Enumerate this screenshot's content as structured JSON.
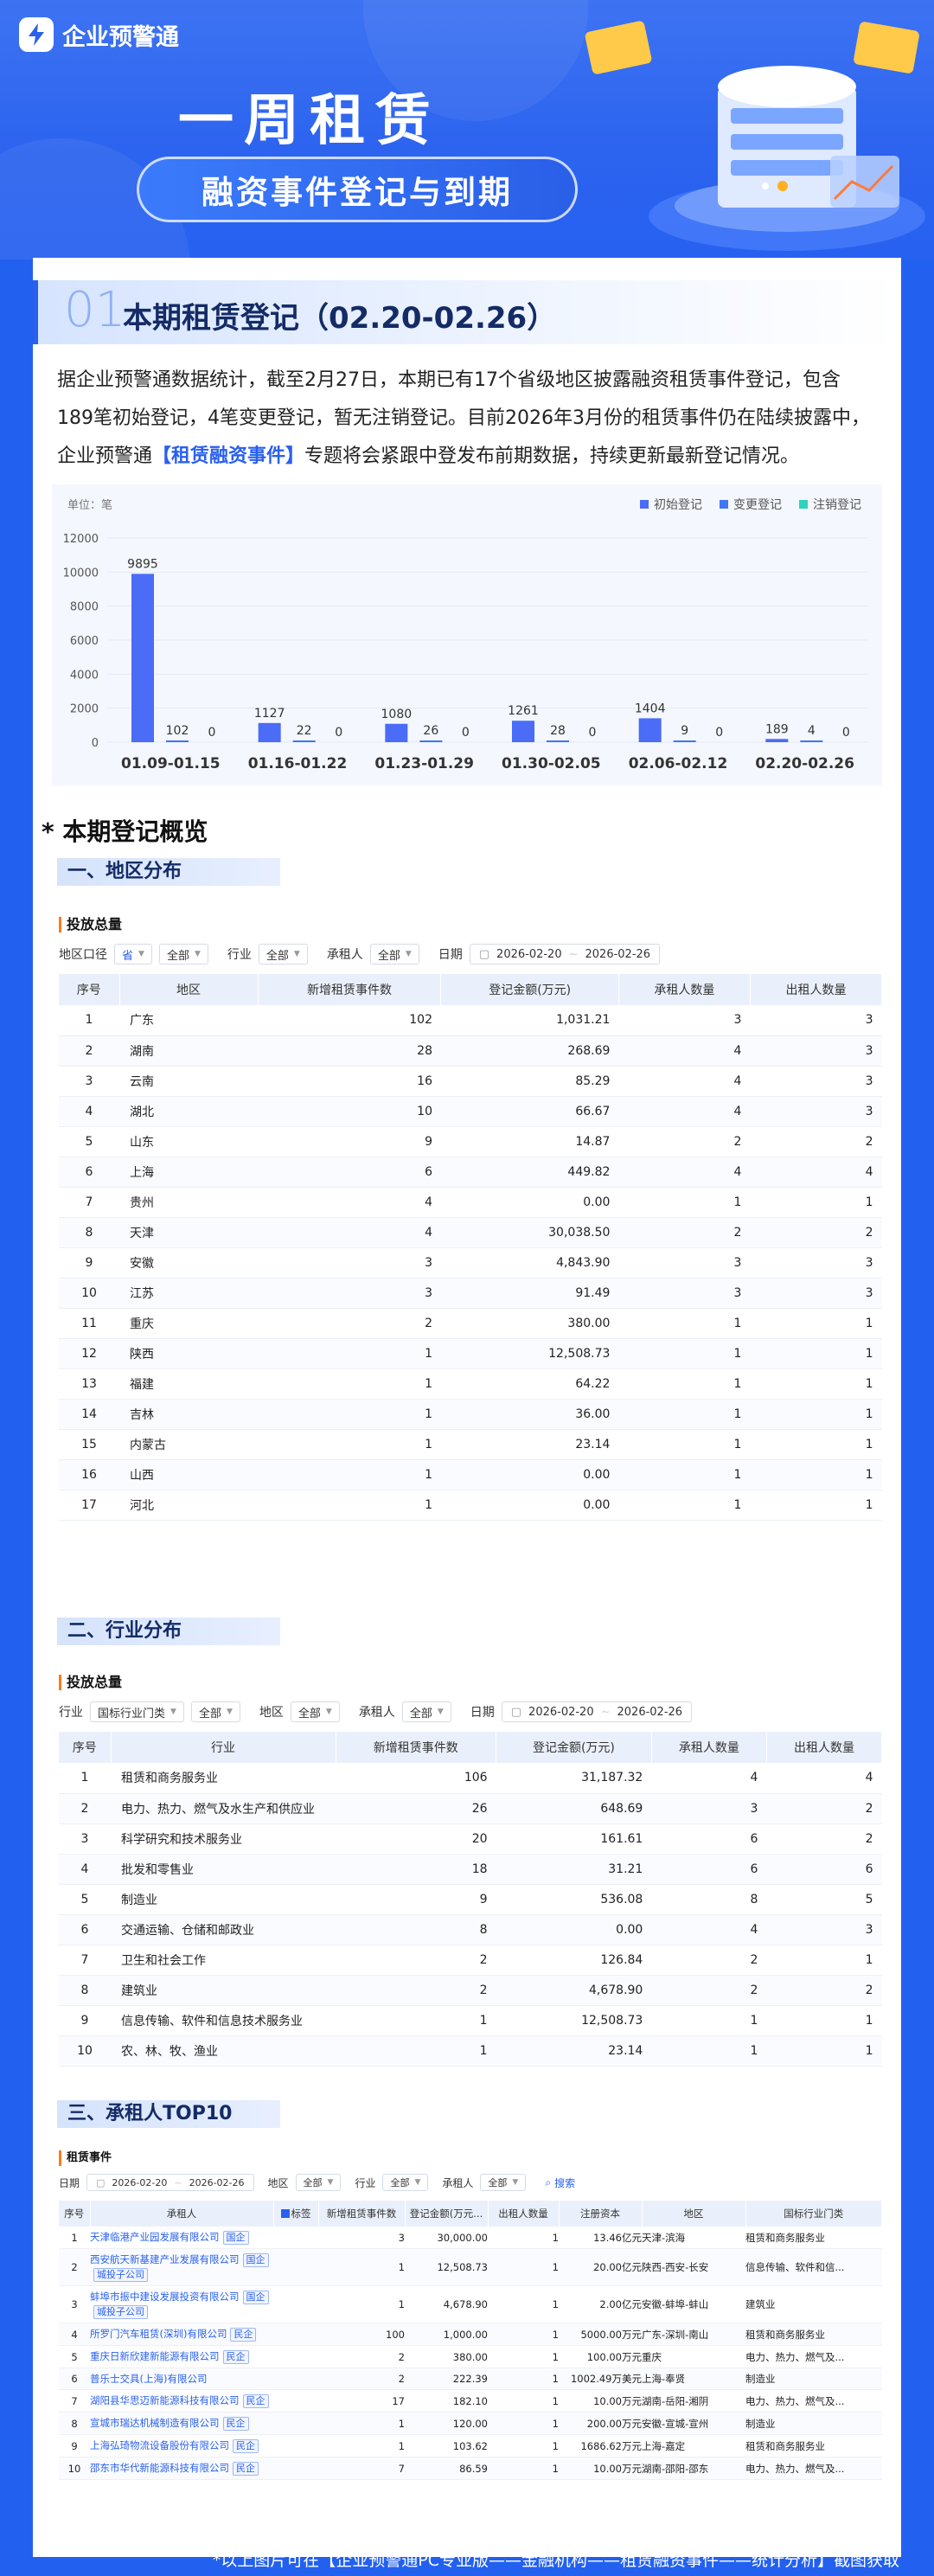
{
  "brand": {
    "name": "企业预警通"
  },
  "hero": {
    "title": "一周租赁",
    "subtitle": "融资事件登记与到期"
  },
  "section1": {
    "number": "01",
    "title": "本期租赁登记（02.20-02.26）"
  },
  "intro": {
    "line1": "据企业预警通数据统计，截至2月27日，本期已有17个省级地区披露融资租赁事件登记，包含",
    "line2": "189笔初始登记，4笔变更登记，暂无注销登记。目前2026年3月份的租赁事件仍在陆续披露中，",
    "line3a": "企业预警通",
    "line3b": "【租赁融资事件】",
    "line3c": "专题将会紧跟中登发布前期数据，持续更新最新登记情况。"
  },
  "chart_data": {
    "type": "bar",
    "unit_label": "单位：笔",
    "categories": [
      "01.09-01.15",
      "01.16-01.22",
      "01.23-01.29",
      "01.30-02.05",
      "02.06-02.12",
      "02.20-02.26"
    ],
    "series": [
      {
        "name": "初始登记",
        "values": [
          9895,
          1127,
          1080,
          1261,
          1404,
          189
        ],
        "color": "#4a6cf7"
      },
      {
        "name": "变更登记",
        "values": [
          102,
          22,
          26,
          28,
          9,
          4
        ],
        "color": "#3f77f4"
      },
      {
        "name": "注销登记",
        "values": [
          0,
          0,
          0,
          0,
          0,
          0
        ],
        "color": "#2ed3c0"
      }
    ],
    "yticks": [
      0,
      2000,
      4000,
      6000,
      8000,
      10000,
      12000
    ],
    "ylim": [
      0,
      12000
    ],
    "legend": "top-right"
  },
  "overview": {
    "title": "*  本期登记概览"
  },
  "region": {
    "subtitle": "一、地区分布",
    "panel_title": "投放总量",
    "filters": {
      "region_label": "地区口径",
      "region_value": "省",
      "all1": "全部",
      "industry_label": "行业",
      "industry_value": "全部",
      "lessee_label": "承租人",
      "lessee_value": "全部",
      "date_label": "日期",
      "date_from": "2026-02-20",
      "date_to": "2026-02-26"
    },
    "headers": [
      "序号",
      "地区",
      "新增租赁事件数",
      "登记金额(万元)",
      "承租人数量",
      "出租人数量"
    ],
    "rows": [
      [
        "1",
        "广东",
        "102",
        "1,031.21",
        "3",
        "3"
      ],
      [
        "2",
        "湖南",
        "28",
        "268.69",
        "4",
        "3"
      ],
      [
        "3",
        "云南",
        "16",
        "85.29",
        "4",
        "3"
      ],
      [
        "4",
        "湖北",
        "10",
        "66.67",
        "4",
        "3"
      ],
      [
        "5",
        "山东",
        "9",
        "14.87",
        "2",
        "2"
      ],
      [
        "6",
        "上海",
        "6",
        "449.82",
        "4",
        "4"
      ],
      [
        "7",
        "贵州",
        "4",
        "0.00",
        "1",
        "1"
      ],
      [
        "8",
        "天津",
        "4",
        "30,038.50",
        "2",
        "2"
      ],
      [
        "9",
        "安徽",
        "3",
        "4,843.90",
        "3",
        "3"
      ],
      [
        "10",
        "江苏",
        "3",
        "91.49",
        "3",
        "3"
      ],
      [
        "11",
        "重庆",
        "2",
        "380.00",
        "1",
        "1"
      ],
      [
        "12",
        "陕西",
        "1",
        "12,508.73",
        "1",
        "1"
      ],
      [
        "13",
        "福建",
        "1",
        "64.22",
        "1",
        "1"
      ],
      [
        "14",
        "吉林",
        "1",
        "36.00",
        "1",
        "1"
      ],
      [
        "15",
        "内蒙古",
        "1",
        "23.14",
        "1",
        "1"
      ],
      [
        "16",
        "山西",
        "1",
        "0.00",
        "1",
        "1"
      ],
      [
        "17",
        "河北",
        "1",
        "0.00",
        "1",
        "1"
      ]
    ]
  },
  "industry": {
    "subtitle": "二、行业分布",
    "panel_title": "投放总量",
    "filters": {
      "industry_label": "行业",
      "industry_value": "国标行业门类",
      "all1": "全部",
      "region_label": "地区",
      "region_value": "全部",
      "lessee_label": "承租人",
      "lessee_value": "全部",
      "date_label": "日期",
      "date_from": "2026-02-20",
      "date_to": "2026-02-26"
    },
    "headers": [
      "序号",
      "行业",
      "新增租赁事件数",
      "登记金额(万元)",
      "承租人数量",
      "出租人数量"
    ],
    "rows": [
      [
        "1",
        "租赁和商务服务业",
        "106",
        "31,187.32",
        "4",
        "4"
      ],
      [
        "2",
        "电力、热力、燃气及水生产和供应业",
        "26",
        "648.69",
        "3",
        "2"
      ],
      [
        "3",
        "科学研究和技术服务业",
        "20",
        "161.61",
        "6",
        "2"
      ],
      [
        "4",
        "批发和零售业",
        "18",
        "31.21",
        "6",
        "6"
      ],
      [
        "5",
        "制造业",
        "9",
        "536.08",
        "8",
        "5"
      ],
      [
        "6",
        "交通运输、仓储和邮政业",
        "8",
        "0.00",
        "4",
        "3"
      ],
      [
        "7",
        "卫生和社会工作",
        "2",
        "126.84",
        "2",
        "1"
      ],
      [
        "8",
        "建筑业",
        "2",
        "4,678.90",
        "2",
        "2"
      ],
      [
        "9",
        "信息传输、软件和信息技术服务业",
        "1",
        "12,508.73",
        "1",
        "1"
      ],
      [
        "10",
        "农、林、牧、渔业",
        "1",
        "23.14",
        "1",
        "1"
      ]
    ]
  },
  "lessee": {
    "subtitle": "三、承租人TOP10",
    "panel_title": "租赁事件",
    "filters": {
      "date_label": "日期",
      "date_from": "2026-02-20",
      "date_to": "2026-02-26",
      "region_label": "地区",
      "region_value": "全部",
      "industry_label": "行业",
      "industry_value": "全部",
      "lessee_label": "承租人",
      "lessee_value": "全部",
      "search": "搜索"
    },
    "headers": [
      "序号",
      "承租人",
      "标签",
      "新增租赁事件数",
      "登记金额(万元...",
      "出租人数量",
      "注册资本",
      "地区",
      "国标行业门类"
    ],
    "rows": [
      {
        "no": "1",
        "name": "天津临港产业园发展有限公司",
        "tags": [
          "国企"
        ],
        "count": "3",
        "amount": "30,000.00",
        "lessors": "1",
        "capital": "13.46亿元",
        "region": "天津-滨海",
        "industry": "租赁和商务服务业"
      },
      {
        "no": "2",
        "name": "西安航天新基建产业发展有限公司",
        "tags": [
          "国企",
          "城投子公司"
        ],
        "count": "1",
        "amount": "12,508.73",
        "lessors": "1",
        "capital": "20.00亿元",
        "region": "陕西-西安-长安",
        "industry": "信息传输、软件和信..."
      },
      {
        "no": "3",
        "name": "蚌埠市振中建设发展投资有限公司",
        "tags": [
          "国企",
          "城投子公司"
        ],
        "count": "1",
        "amount": "4,678.90",
        "lessors": "1",
        "capital": "2.00亿元",
        "region": "安徽-蚌埠-蚌山",
        "industry": "建筑业"
      },
      {
        "no": "4",
        "name": "所罗门汽车租赁(深圳)有限公司",
        "tags": [
          "民企"
        ],
        "count": "100",
        "amount": "1,000.00",
        "lessors": "1",
        "capital": "5000.00万元",
        "region": "广东-深圳-南山",
        "industry": "租赁和商务服务业"
      },
      {
        "no": "5",
        "name": "重庆日新欣建新能源有限公司",
        "tags": [
          "民企"
        ],
        "count": "2",
        "amount": "380.00",
        "lessors": "1",
        "capital": "100.00万元",
        "region": "重庆",
        "industry": "电力、热力、燃气及..."
      },
      {
        "no": "6",
        "name": "普乐士交具(上海)有限公司",
        "tags": [],
        "count": "2",
        "amount": "222.39",
        "lessors": "1",
        "capital": "1002.49万美元",
        "region": "上海-奉贤",
        "industry": "制造业"
      },
      {
        "no": "7",
        "name": "湖阳县华思迈新能源科技有限公司",
        "tags": [
          "民企"
        ],
        "count": "17",
        "amount": "182.10",
        "lessors": "1",
        "capital": "10.00万元",
        "region": "湖南-岳阳-湘阴",
        "industry": "电力、热力、燃气及..."
      },
      {
        "no": "8",
        "name": "宣城市瑞达机械制造有限公司",
        "tags": [
          "民企"
        ],
        "count": "1",
        "amount": "120.00",
        "lessors": "1",
        "capital": "200.00万元",
        "region": "安徽-宣城-宣州",
        "industry": "制造业"
      },
      {
        "no": "9",
        "name": "上海弘琦物流设备股份有限公司",
        "tags": [
          "民企"
        ],
        "count": "1",
        "amount": "103.62",
        "lessors": "1",
        "capital": "1686.62万元",
        "region": "上海-嘉定",
        "industry": "租赁和商务服务业"
      },
      {
        "no": "10",
        "name": "邵东市华代新能源科技有限公司",
        "tags": [
          "民企"
        ],
        "count": "7",
        "amount": "86.59",
        "lessors": "1",
        "capital": "10.00万元",
        "region": "湖南-邵阳-邵东",
        "industry": "电力、热力、燃气及..."
      }
    ]
  },
  "footer": "*以上图片可在【企业预警通PC专业版——金融机构——租赁融资事件——统计分析】截图获取"
}
